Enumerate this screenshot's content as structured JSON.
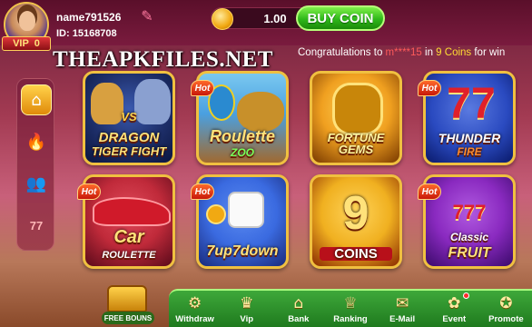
{
  "user": {
    "name": "name791526",
    "id": "ID: 15168708",
    "vip_label": "VIP",
    "vip_level": "0"
  },
  "wallet": {
    "balance": "1.00",
    "buy_label": "BUY COIN"
  },
  "watermark": "THEAPKFILES.NET",
  "ticker": {
    "prefix": "Congratulations to ",
    "masked_user": "m****15",
    "middle": " in ",
    "amount": "9 Coins",
    "suffix": " for win"
  },
  "nav": {
    "items": [
      {
        "name": "home",
        "icon": "home-icon",
        "active": true
      },
      {
        "name": "hot",
        "icon": "flame-icon",
        "active": false
      },
      {
        "name": "multiplayer",
        "icon": "people-icon",
        "active": false
      },
      {
        "name": "slots",
        "icon": "777-icon",
        "active": false
      }
    ]
  },
  "games": [
    {
      "title": "DRAGON TIGER FIGHT",
      "line1": "VS",
      "line2": "DRAGON",
      "line3": "TIGER FIGHT",
      "hot": false,
      "colors": [
        "#1e2f6a",
        "#0a1640"
      ]
    },
    {
      "title": "Roulette ZOO",
      "line1": "Roulette",
      "line2": "ZOO",
      "hot": true,
      "colors": [
        "#4aa0e0",
        "#a06a30"
      ]
    },
    {
      "title": "FORTUNE GEMS",
      "line1": "FORTUNE GEMS",
      "hot": false,
      "colors": [
        "#f0a020",
        "#7a3a00"
      ]
    },
    {
      "title": "THUNDER FIRE",
      "line1": "THUNDER",
      "line2": "FIRE",
      "hot": true,
      "colors": [
        "#2a4ac0",
        "#0a1a6a"
      ]
    },
    {
      "title": "Car ROULETTE",
      "line1": "Car",
      "line2": "ROULETTE",
      "hot": true,
      "colors": [
        "#c02a3a",
        "#5a0a1a"
      ]
    },
    {
      "title": "7up7down",
      "line1": "7up7down",
      "hot": true,
      "colors": [
        "#3a6ae0",
        "#1a2a7a"
      ]
    },
    {
      "title": "9 COINS",
      "line1": "9",
      "line2": "COINS",
      "hot": false,
      "colors": [
        "#f0b020",
        "#8a2a00"
      ]
    },
    {
      "title": "777 Classic FRUIT",
      "line1": "777",
      "line2": "Classic",
      "line3": "FRUIT",
      "hot": true,
      "colors": [
        "#8a2ac0",
        "#3a0a6a"
      ]
    }
  ],
  "hot_label": "Hot",
  "bonus_label": "FREE BOUNS",
  "tabs": [
    {
      "label": "Withdraw",
      "icon": "withdraw-icon",
      "glyph": "⚙"
    },
    {
      "label": "Vip",
      "icon": "vip-icon",
      "glyph": "♛"
    },
    {
      "label": "Bank",
      "icon": "bank-icon",
      "glyph": "🏛"
    },
    {
      "label": "Ranking",
      "icon": "trophy-icon",
      "glyph": "🏆"
    },
    {
      "label": "E-Mail",
      "icon": "mail-icon",
      "glyph": "✉"
    },
    {
      "label": "Event",
      "icon": "gift-icon",
      "glyph": "🎁"
    },
    {
      "label": "Promote",
      "icon": "promote-icon",
      "glyph": "📢"
    }
  ],
  "colors": {
    "accent_green": "#2fb81a",
    "tile_border": "#f0c040",
    "ticker_highlight": "#ffdd33"
  }
}
